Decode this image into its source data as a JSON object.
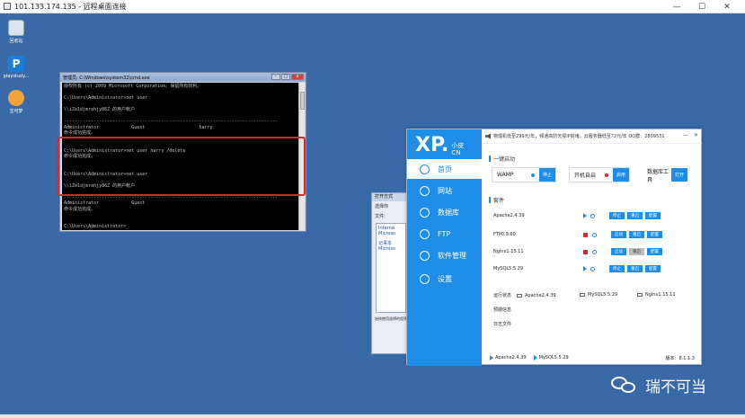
{
  "rdp": {
    "title": "101.133.174.135 - 远程桌面连接",
    "controls": [
      "—",
      "☐",
      "✕"
    ]
  },
  "desktop": {
    "icons": [
      {
        "label": "回收站"
      },
      {
        "label": "playstudy..."
      },
      {
        "label": "宝可梦"
      }
    ]
  },
  "cmd": {
    "title": "管理员: C:\\Windows\\system32\\cmd.exe",
    "lines": [
      "版权所有 (c) 2009 Microsoft Corporation。保留所有权利。",
      "",
      "C:\\Users\\Administrator>net user",
      "",
      "\\\\iZe1djmrehjy86Z 的用户帐户",
      "",
      "-------------------------------------------------------------------------------",
      "Administrator            Guest                    harry",
      "命令成功完成。",
      "",
      "",
      "C:\\Users\\Administrator>net user harry /delete",
      "命令成功完成。",
      "",
      "",
      "C:\\Users\\Administrator>net user",
      "",
      "\\\\iZe1djmrehjy86Z 的用户帐户",
      "",
      "-------------------------------------------------------------------------------",
      "Administrator            Guest",
      "命令成功完成。",
      "",
      "",
      "C:\\Users\\Administrator>_"
    ]
  },
  "dialog": {
    "title": "打开方式",
    "line1": "选择你",
    "line2": "文件:",
    "items": [
      "Interne Microso",
      "记事本 Microso"
    ],
    "checkbox": "始终使用选择的程序"
  },
  "xp": {
    "logo_big": "XP.",
    "logo_small_1": "小皮",
    "logo_small_2": "CN",
    "topbar_text": "物理机低至299元/年，频通高防无视IP封堵，云服务器低至72元/年 QQ群：2809531",
    "nav": [
      {
        "label": "首页",
        "icon": "home-icon"
      },
      {
        "label": "网站",
        "icon": "globe-icon"
      },
      {
        "label": "数据库",
        "icon": "database-icon"
      },
      {
        "label": "FTP",
        "icon": "ftp-icon"
      },
      {
        "label": "软件管理",
        "icon": "sliders-icon"
      },
      {
        "label": "设置",
        "icon": "gear-icon"
      }
    ],
    "quick_title": "一键启动",
    "quick": [
      {
        "label": "WAMP",
        "dot": "#1e8de8",
        "btn": "停止"
      },
      {
        "label": "开机自启",
        "dot": "#e0262b",
        "btn": "启用"
      },
      {
        "label": "数据库工具",
        "btn": "打开"
      }
    ],
    "svc_title": "套件",
    "services": [
      {
        "name": "Apache2.4.39",
        "state_color": "#1e8de8",
        "btn1": "停止",
        "btn2": "重启",
        "btn3": "配置"
      },
      {
        "name": "FTP0.9.60",
        "state_color": "#e0262b",
        "btn1": "启动",
        "btn2": "重启",
        "btn3": "配置"
      },
      {
        "name": "Nginx1.15.11",
        "state_color": "#e0262b",
        "btn1": "启动",
        "btn2": "重启",
        "btn3": "配置"
      },
      {
        "name": "MySQL5.5.29",
        "state_color": "#1e8de8",
        "btn1": "停止",
        "btn2": "重启",
        "btn3": "配置"
      }
    ],
    "run_status_label": "运行状态",
    "folders": [
      "Apache2.4.39",
      "MySQL5.5.29",
      "Nginx1.15.11"
    ],
    "misc": [
      "预期信息",
      "日志文件"
    ],
    "bottom": [
      "Apache2.4.39",
      "MySQL5.5.29"
    ],
    "version": "版本：8.1.1.3"
  },
  "watermark": {
    "text": "瑞不可当"
  }
}
